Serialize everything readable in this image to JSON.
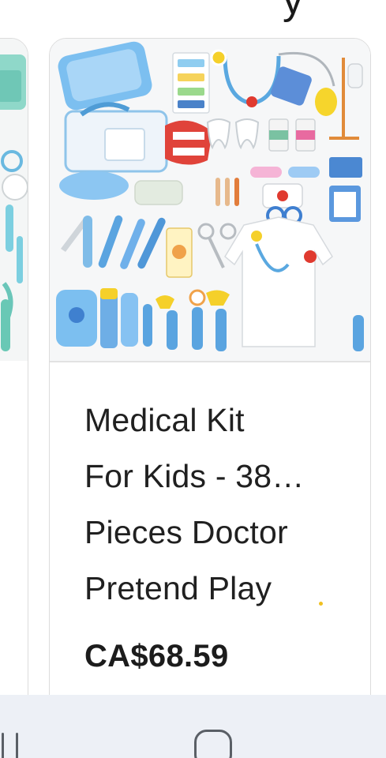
{
  "header": {
    "cropped_glyph": "y"
  },
  "products": [
    {
      "image_icon": "medical-kit-toy-photo",
      "accent_colors": [
        "#7fc4e8",
        "#7ed3c6",
        "#e8432f"
      ]
    },
    {
      "title_lines": [
        "Medical Kit",
        "For Kids - 38…",
        "Pieces Doctor",
        "Pretend Play"
      ],
      "price": "CA$68.59",
      "image_icon": "medical-kit-toy-photo",
      "accent_colors": [
        "#6fb4ea",
        "#e03a2f",
        "#f5d02a"
      ]
    }
  ],
  "navigation": {
    "recent_icon": "recent-apps-icon",
    "home_icon": "home-icon"
  }
}
